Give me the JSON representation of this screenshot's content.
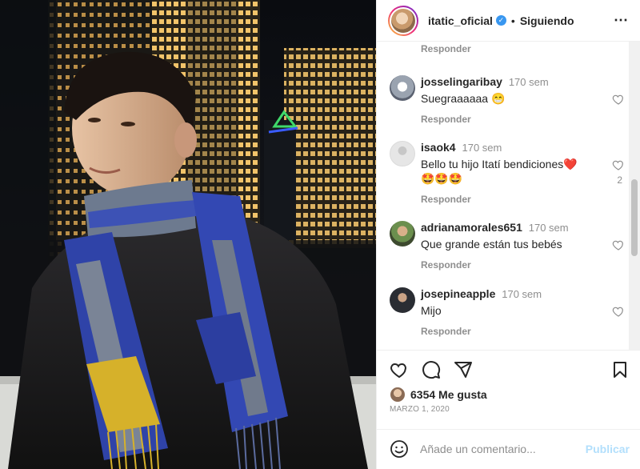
{
  "header": {
    "username": "itatic_oficial",
    "following_label": "Siguiendo",
    "dot": "•"
  },
  "comments": {
    "top_reply_label": "Responder",
    "items": [
      {
        "user": "josselingaribay",
        "time": "170 sem",
        "text": "Suegraaaaaa 😁",
        "reply_label": "Responder",
        "likes": ""
      },
      {
        "user": "isaok4",
        "time": "170 sem",
        "text": "Bello tu hijo Itatí bendiciones❤️🤩🤩🤩",
        "reply_label": "Responder",
        "likes": "2"
      },
      {
        "user": "adrianamorales651",
        "time": "170 sem",
        "text": "Que grande están tus bebés",
        "reply_label": "Responder",
        "likes": ""
      },
      {
        "user": "josepineapple",
        "time": "170 sem",
        "text": "Mijo",
        "reply_label": "Responder",
        "likes": ""
      }
    ]
  },
  "post": {
    "likes_text": "6354 Me gusta",
    "date": "MARZO 1, 2020"
  },
  "add_comment": {
    "placeholder": "Añade un comentario...",
    "publish_label": "Publicar"
  },
  "colors": {
    "verified": "#3897f0",
    "publish_disabled": "#b2dffc",
    "muted": "#8e8e8e"
  },
  "icons": [
    "heart-icon",
    "comment-icon",
    "share-icon",
    "bookmark-icon",
    "emoji-icon",
    "more-options-icon",
    "verified-badge-icon"
  ]
}
